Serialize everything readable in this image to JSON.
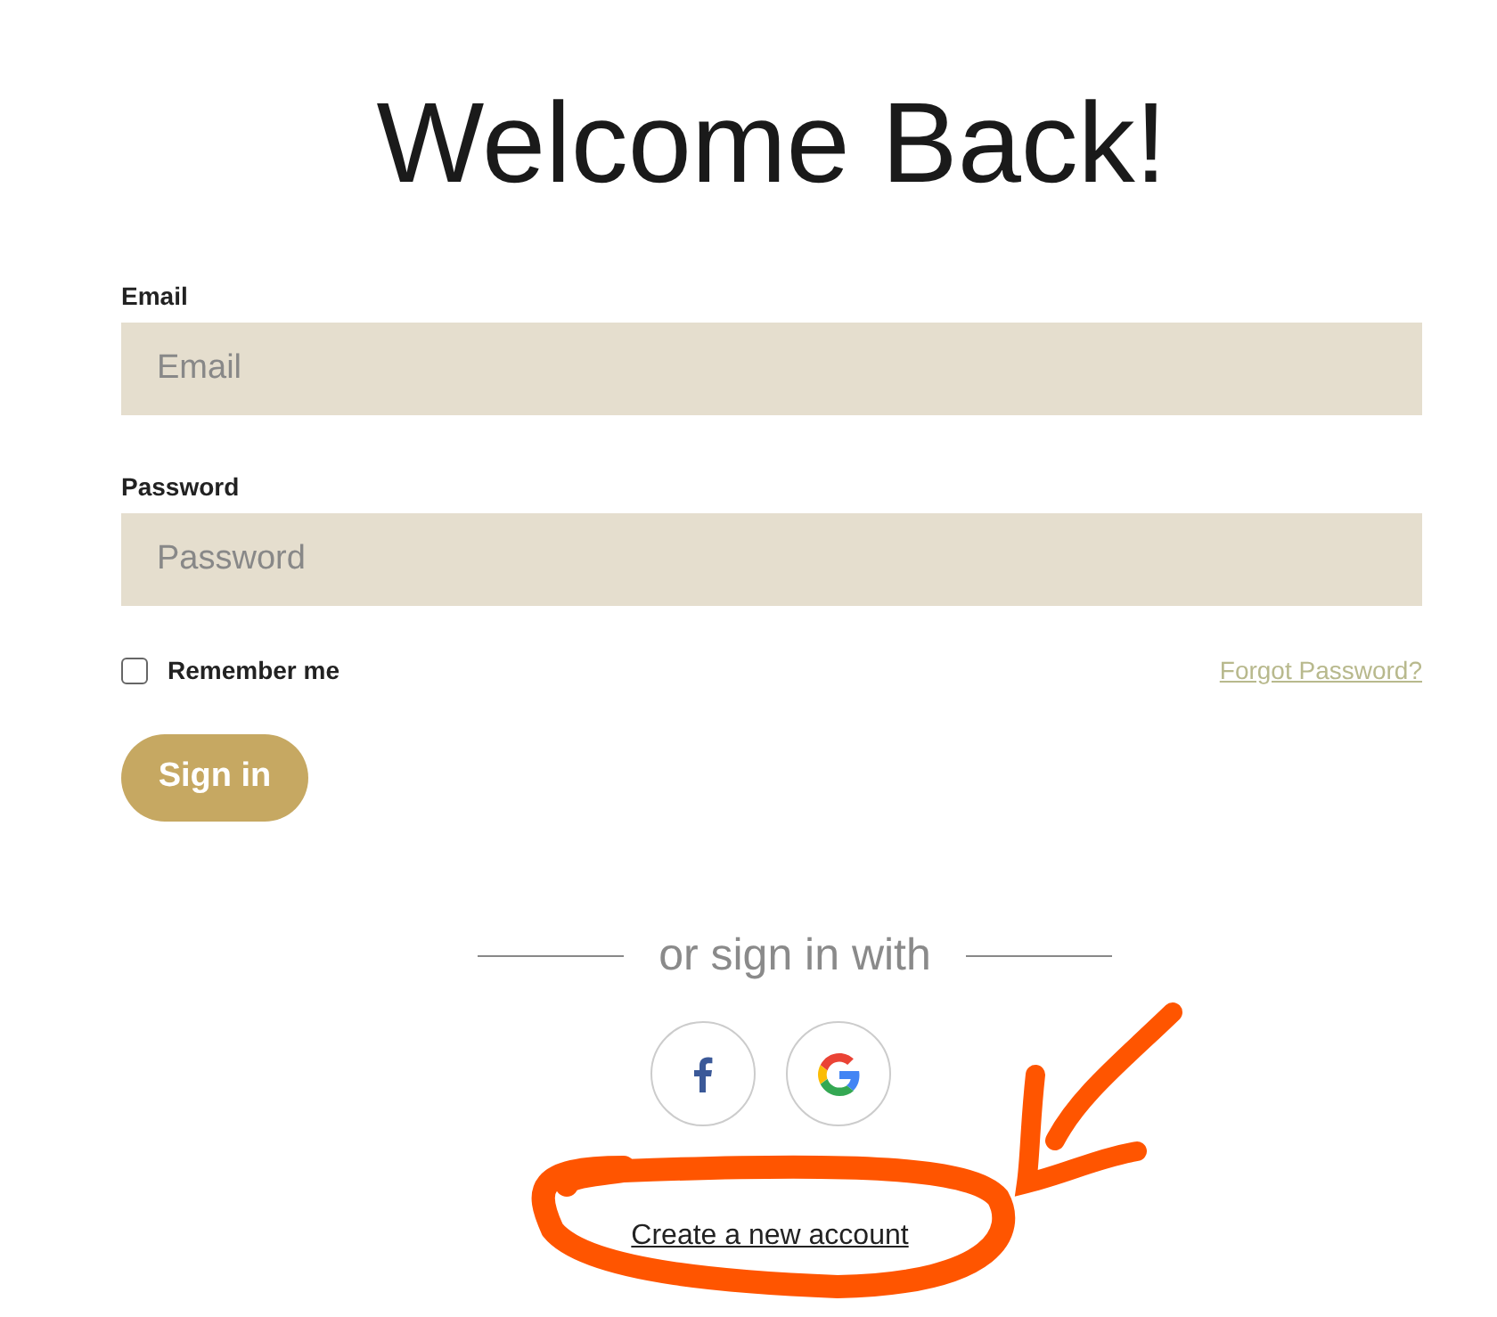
{
  "title": "Welcome Back!",
  "fields": [
    {
      "label": "Email",
      "placeholder": "Email"
    },
    {
      "label": "Password",
      "placeholder": "Password"
    }
  ],
  "remember": {
    "label": "Remember me",
    "checked": false
  },
  "forgot_link": "Forgot Password?",
  "sign_in_button": "Sign in",
  "divider_text": "or sign in with",
  "social_buttons": [
    {
      "kind": "facebook"
    },
    {
      "kind": "google"
    }
  ],
  "create_account_link": "Create a new account"
}
